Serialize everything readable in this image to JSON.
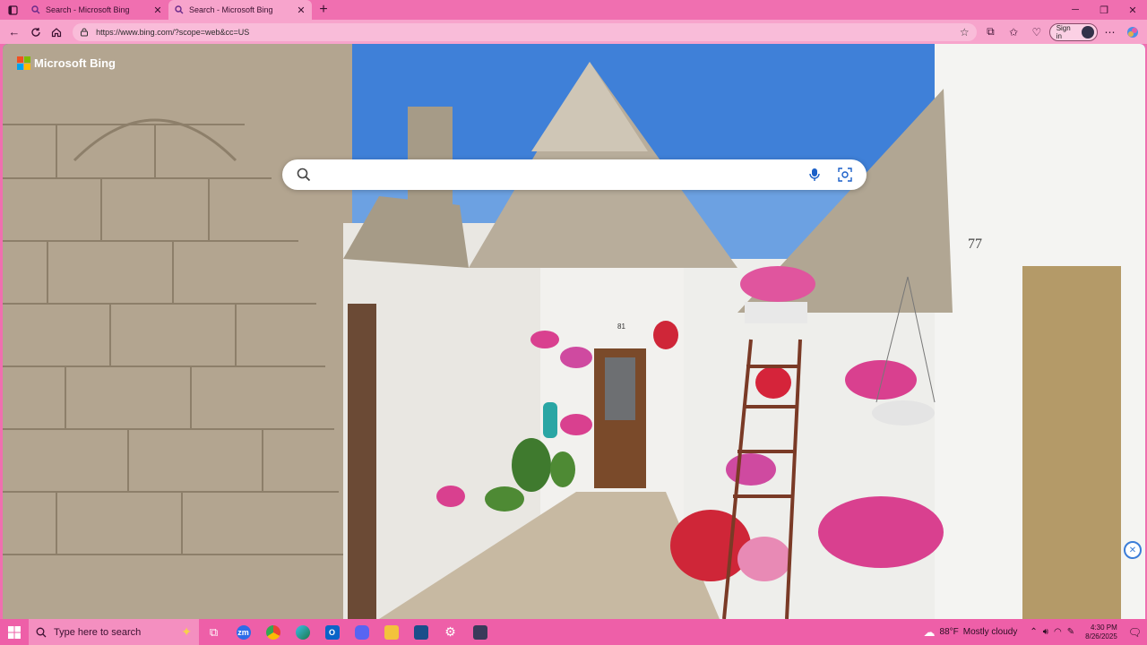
{
  "browser": {
    "tabs": [
      {
        "title": "Search - Microsoft Bing",
        "active": false
      },
      {
        "title": "Search - Microsoft Bing",
        "active": true
      }
    ],
    "new_tab_label": "+",
    "url": "https://www.bing.com/?scope=web&cc=US",
    "signin_label": "Sign in"
  },
  "bing": {
    "logo_text": "Microsoft Bing",
    "search_placeholder": "",
    "house_number": "77",
    "door_number": "81"
  },
  "taskbar": {
    "search_placeholder": "Type here to search",
    "apps": [
      {
        "name": "task-view",
        "label": ""
      },
      {
        "name": "zoom",
        "label": "zm"
      },
      {
        "name": "chrome",
        "label": ""
      },
      {
        "name": "edge",
        "label": ""
      },
      {
        "name": "outlook",
        "label": "O"
      },
      {
        "name": "discord",
        "label": ""
      },
      {
        "name": "file-explorer",
        "label": ""
      },
      {
        "name": "camera-app",
        "label": ""
      },
      {
        "name": "settings",
        "label": ""
      },
      {
        "name": "chat-app",
        "label": ""
      }
    ],
    "weather_temp": "88°F",
    "weather_text": "Mostly cloudy",
    "time": "4:30 PM",
    "date": "8/26/2025"
  },
  "colors": {
    "chrome_pink": "#f06fb0",
    "toolbar_pink": "#f7a4cc",
    "taskbar_pink": "#ee5fa8"
  }
}
